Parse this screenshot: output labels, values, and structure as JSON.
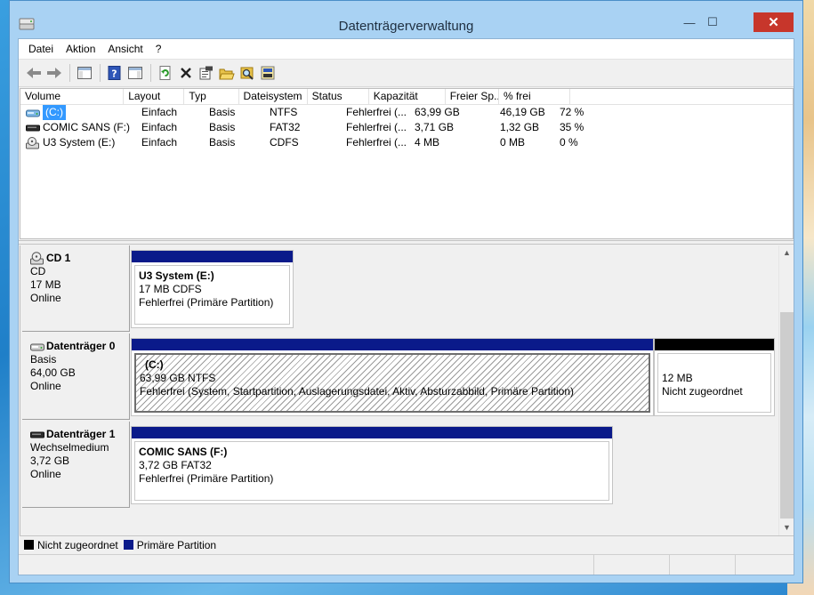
{
  "window": {
    "title": "Datenträgerverwaltung",
    "minimize": "—",
    "maximize": "☐",
    "close": "✕"
  },
  "menu": [
    "Datei",
    "Aktion",
    "Ansicht",
    "?"
  ],
  "toolbar": {
    "buttons": [
      "back-icon",
      "forward-icon",
      "show-hide-console-tree-icon",
      "help-icon",
      "show-hide-action-pane-icon",
      "refresh-icon",
      "delete-icon",
      "properties-icon",
      "open-icon",
      "explore-icon",
      "disk-settings-icon"
    ]
  },
  "volumes": {
    "headers": [
      "Volume",
      "Layout",
      "Typ",
      "Dateisystem",
      "Status",
      "Kapazität",
      "Freier Sp...",
      "% frei",
      ""
    ],
    "rows": [
      {
        "volume": "(C:)",
        "layout": "Einfach",
        "typ": "Basis",
        "fs": "NTFS",
        "status": "Fehlerfrei (...",
        "kap": "63,99 GB",
        "frei": "46,19 GB",
        "pct": "72 %",
        "icon": "hard-disk-icon",
        "selected": true
      },
      {
        "volume": "COMIC SANS (F:)",
        "layout": "Einfach",
        "typ": "Basis",
        "fs": "FAT32",
        "status": "Fehlerfrei (...",
        "kap": "3,71 GB",
        "frei": "1,32 GB",
        "pct": "35 %",
        "icon": "removable-disk-icon",
        "selected": false
      },
      {
        "volume": "U3 System (E:)",
        "layout": "Einfach",
        "typ": "Basis",
        "fs": "CDFS",
        "status": "Fehlerfrei (...",
        "kap": "4 MB",
        "frei": "0 MB",
        "pct": "0 %",
        "icon": "cd-drive-icon",
        "selected": false
      }
    ]
  },
  "disks": [
    {
      "name": "CD 1",
      "type": "CD",
      "size": "17 MB",
      "state": "Online",
      "icon": "cd-drive-icon",
      "partitions": [
        {
          "title": "U3 System  (E:)",
          "info": "17 MB CDFS",
          "status": "Fehlerfrei (Primäre Partition)",
          "kind": "primary"
        }
      ]
    },
    {
      "name": "Datenträger 0",
      "type": "Basis",
      "size": "64,00 GB",
      "state": "Online",
      "icon": "hard-disk-icon",
      "partitions": [
        {
          "title": "(C:)",
          "info": "63,99 GB NTFS",
          "status": "Fehlerfrei (System, Startpartition, Auslagerungsdatei, Aktiv, Absturzabbild, Primäre Partition)",
          "kind": "primary"
        },
        {
          "title": "",
          "info": "12 MB",
          "status": "Nicht zugeordnet",
          "kind": "unallocated"
        }
      ]
    },
    {
      "name": "Datenträger 1",
      "type": "Wechselmedium",
      "size": "3,72 GB",
      "state": "Online",
      "icon": "removable-disk-icon",
      "partitions": [
        {
          "title": "COMIC SANS  (F:)",
          "info": "3,72 GB FAT32",
          "status": "Fehlerfrei (Primäre Partition)",
          "kind": "primary"
        }
      ]
    }
  ],
  "legend": [
    {
      "label": "Nicht zugeordnet",
      "color": "#000000"
    },
    {
      "label": "Primäre Partition",
      "color": "#0a1a8a"
    }
  ],
  "colors": {
    "primary_bar": "#0a1a8a",
    "unallocated_bar": "#000000",
    "selection": "#3399ff",
    "close_button": "#c7362b"
  }
}
